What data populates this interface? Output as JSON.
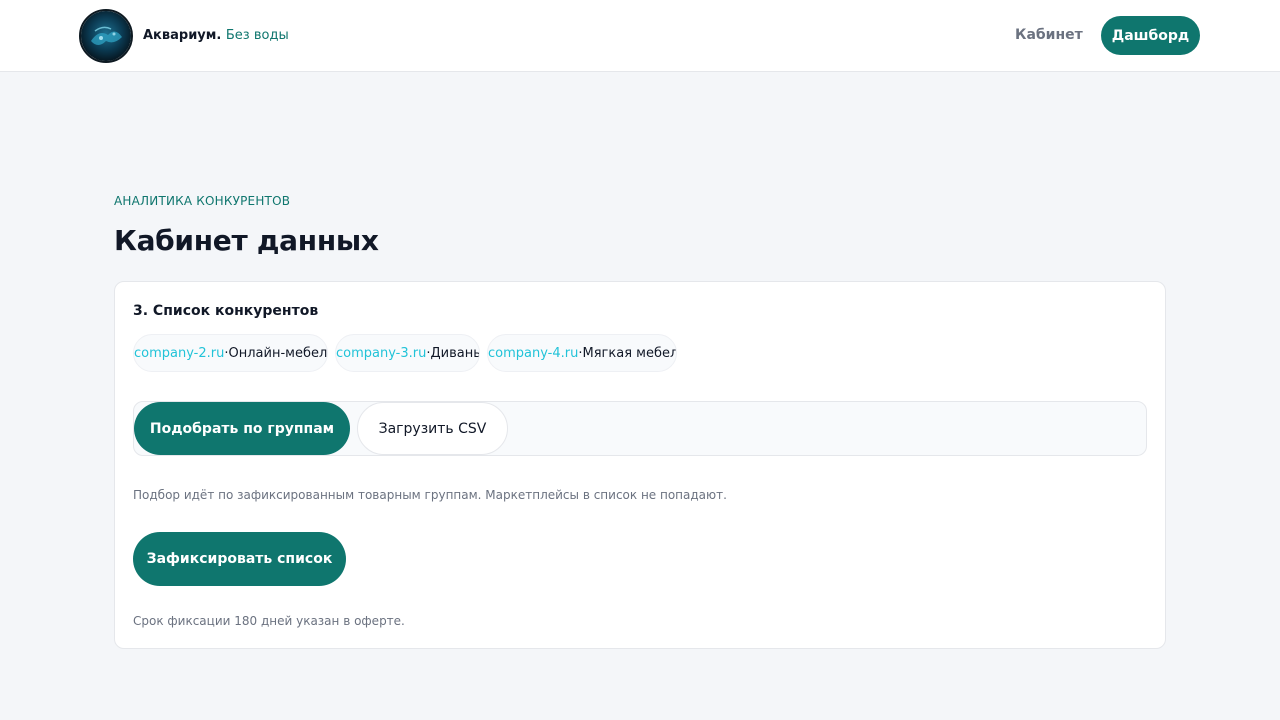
{
  "header": {
    "brand_name": "Аквариум.",
    "brand_tagline": "Без воды",
    "nav_link": "Кабинет",
    "nav_button": "Дашборд",
    "logo_icon": "aquarium-logo-icon"
  },
  "page": {
    "eyebrow": "АНАЛИТИКА КОНКУРЕНТОВ",
    "title": "Кабинет данных"
  },
  "card": {
    "title": "3. Список конкурентов",
    "competitors": [
      {
        "domain": "company-2.ru",
        "separator": " · ",
        "category": "Онлайн-мебель"
      },
      {
        "domain": "company-3.ru",
        "separator": " · ",
        "category": "Диваны"
      },
      {
        "domain": "company-4.ru",
        "separator": " · ",
        "category": "Мягкая мебель"
      }
    ],
    "segments": {
      "by_groups": "Подобрать по группам",
      "upload_csv": "Загрузить CSV"
    },
    "hint": "Подбор идёт по зафиксированным товарным группам. Маркетплейсы в список не попадают.",
    "fix_button": "Зафиксировать список",
    "footnote": "Срок фиксации 180 дней указан в оферте."
  },
  "colors": {
    "accent": "#0f766e",
    "domain_link": "#22c3d8",
    "background": "#f4f6f9"
  }
}
